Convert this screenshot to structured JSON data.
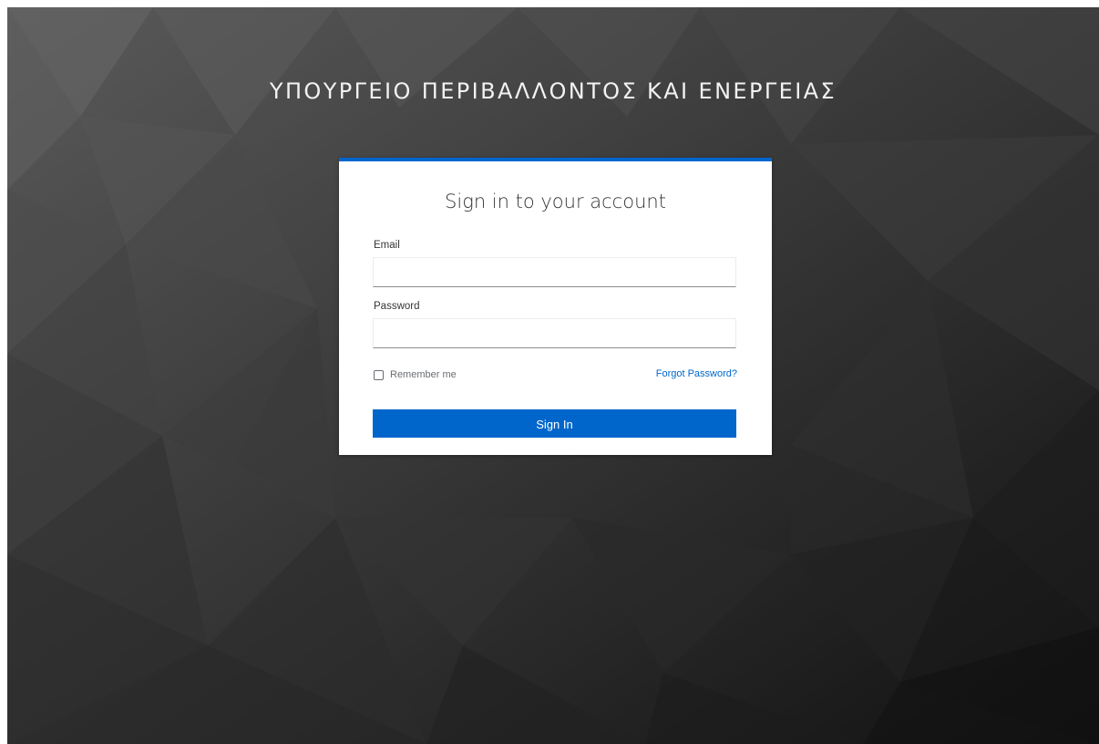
{
  "realm": {
    "title": "ΥΠΟΥΡΓΕΙΟ ΠΕΡΙΒΑΛΛΟΝΤΟΣ ΚΑΙ ΕΝΕΡΓΕΙΑΣ"
  },
  "login": {
    "heading": "Sign in to your account",
    "email_label": "Email",
    "email_value": "",
    "password_label": "Password",
    "password_value": "",
    "remember_label": "Remember me",
    "remember_checked": false,
    "forgot_link": "Forgot Password?",
    "submit_label": "Sign In"
  },
  "colors": {
    "accent": "#0066cc",
    "background": "#3a3a3a",
    "card": "#ffffff",
    "heading_text": "#363636",
    "muted_text": "#6a6e73"
  }
}
